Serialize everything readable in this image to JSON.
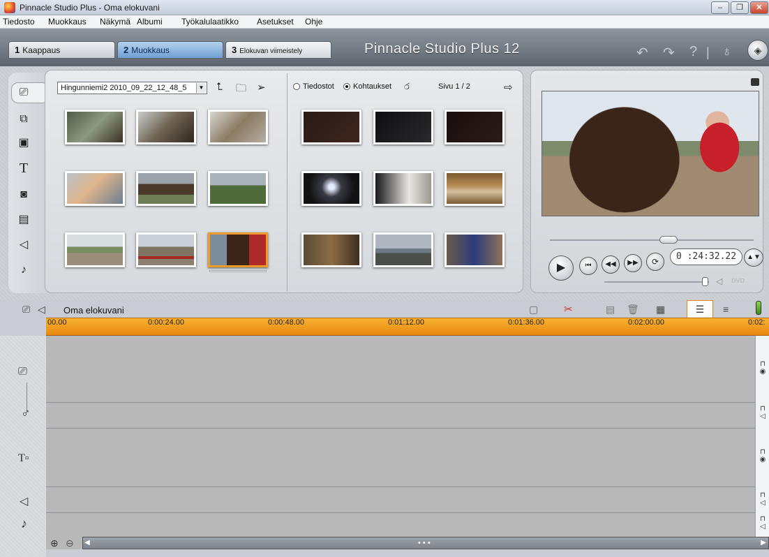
{
  "window": {
    "title": "Pinnacle Studio Plus - Oma elokuvani"
  },
  "menu": [
    "Tiedosto",
    "Muokkaus",
    "Näkymä",
    "Albumi",
    "Työkalulaatikko",
    "Asetukset",
    "Ohje"
  ],
  "tabs": [
    {
      "num": "1",
      "label": "Kaappaus"
    },
    {
      "num": "2",
      "label": "Muokkaus"
    },
    {
      "num": "3",
      "label": "Elokuvan viimeistely"
    }
  ],
  "brand": "Pinnacle Studio Plus 12",
  "album": {
    "folder": "Hingunniemi2 2010_09_22_12_48_5",
    "radio_files": "Tiedostot",
    "radio_scenes": "Kohtaukset",
    "page": "Sivu 1 / 2"
  },
  "preview": {
    "timecode": "0 :24:32.22",
    "dvd": "DVD"
  },
  "timeline": {
    "title": "Oma elokuvani",
    "ticks": [
      "00.00",
      "0:00:24.00",
      "0:00:48.00",
      "0:01:12.00",
      "0:01:36.00",
      "0:02:00.00",
      "0:02:"
    ]
  },
  "colors": {
    "accent": "#f09a2a",
    "tab_active": "#6f9fd2"
  }
}
